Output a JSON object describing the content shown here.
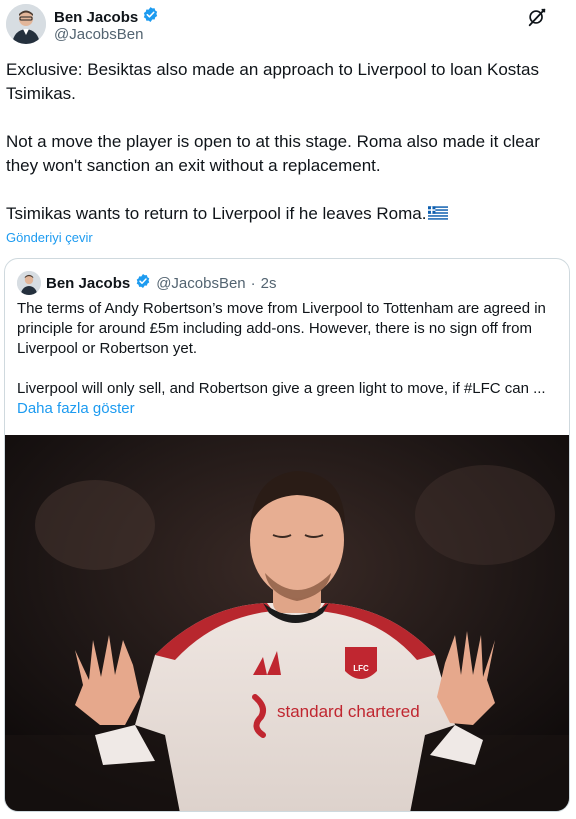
{
  "author": {
    "name": "Ben Jacobs",
    "handle": "@JacobsBen",
    "verified": true
  },
  "tweet": {
    "paragraphs": [
      "Exclusive: Besiktas also made an approach to Liverpool to loan Kostas Tsimikas.",
      "Not a move the player is open to at this stage. Roma also made it clear they won't sanction an exit without a replacement.",
      "Tsimikas wants to return to Liverpool if he leaves Roma."
    ],
    "flag_icon": "greece-flag-icon",
    "translate_label": "Gönderiyi çevir"
  },
  "quoted": {
    "name": "Ben Jacobs",
    "handle": "@JacobsBen",
    "separator": "·",
    "time": "2s",
    "paragraphs": [
      "The terms of Andy Robertson’s move from Liverpool to Tottenham are agreed in principle for around £5m including add-ons. However, there is no sign off from Liverpool or Robertson yet.",
      "Liverpool will only sell, and Robertson give a green light to move, if #LFC can ..."
    ],
    "show_more_label": "Daha fazla göster",
    "media": {
      "kit_brand": "standard chartered",
      "badge_text": "LFC"
    }
  },
  "colors": {
    "link": "#1d9bf0",
    "verified": "#1d9bf0",
    "secondary_text": "#536471",
    "border": "#cfd9de"
  }
}
